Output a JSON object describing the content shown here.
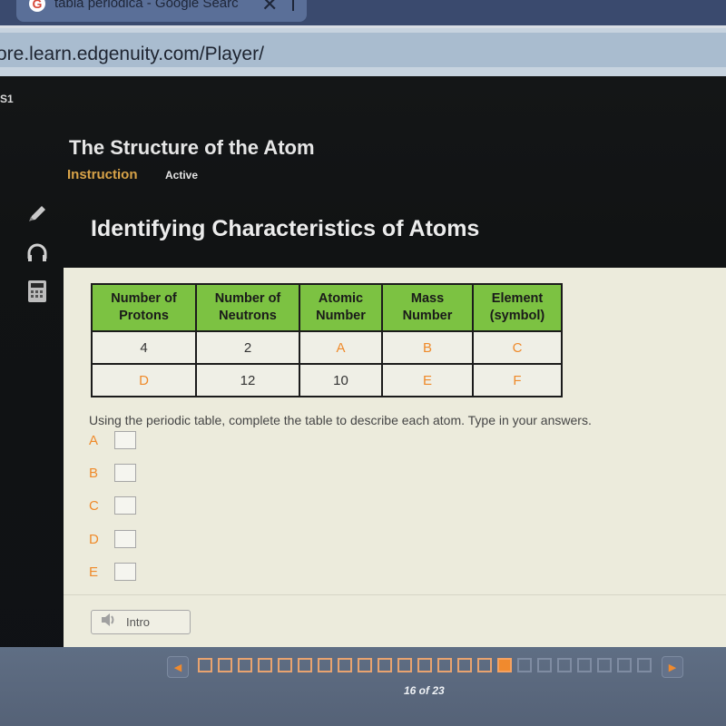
{
  "browser": {
    "tab_title": "tabla periodica - Google Searc",
    "tab_icon": "google-icon",
    "tab_close": "✕",
    "url": "ore.learn.edgenuity.com/Player/"
  },
  "app": {
    "course_code": "S1",
    "course_title": "The Structure of the Atom",
    "section": "Instruction",
    "status": "Active",
    "tools": [
      {
        "name": "pencil-icon"
      },
      {
        "name": "headphones-icon"
      },
      {
        "name": "calculator-icon"
      }
    ],
    "lesson_title": "Identifying Characteristics of Atoms"
  },
  "table": {
    "headers": [
      [
        "Number of",
        "Protons"
      ],
      [
        "Number of",
        "Neutrons"
      ],
      [
        "Atomic",
        "Number"
      ],
      [
        "Mass",
        "Number"
      ],
      [
        "Element",
        "(symbol)"
      ]
    ],
    "rows": [
      [
        "4",
        "2",
        "A",
        "B",
        "C"
      ],
      [
        "D",
        "12",
        "10",
        "E",
        "F"
      ]
    ],
    "blank_cells": [
      "A",
      "B",
      "C",
      "D",
      "E",
      "F"
    ],
    "accent_color": "#7cc242",
    "blank_color": "#ef8a2a"
  },
  "question": {
    "instructions": "Using the periodic table, complete the table to describe each atom. Type in your answers.",
    "answers": [
      {
        "label": "A",
        "value": ""
      },
      {
        "label": "B",
        "value": ""
      },
      {
        "label": "C",
        "value": ""
      },
      {
        "label": "D",
        "value": ""
      },
      {
        "label": "E",
        "value": ""
      }
    ]
  },
  "intro_button": {
    "label": "Intro",
    "icon": "speaker-icon"
  },
  "navigation": {
    "current_page": 16,
    "total_pages": 23,
    "counter_text": "16 of 23",
    "prev_icon": "◀",
    "next_icon": "▶",
    "accent_color": "#f08a2e"
  }
}
